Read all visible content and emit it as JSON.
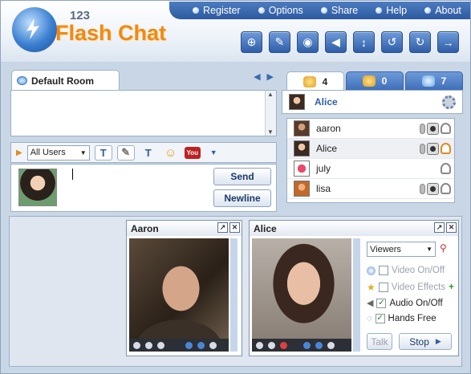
{
  "logo": {
    "number": "123",
    "text": "Flash Chat"
  },
  "topnav": [
    {
      "label": "Register"
    },
    {
      "label": "Options"
    },
    {
      "label": "Share"
    },
    {
      "label": "Help"
    },
    {
      "label": "About"
    }
  ],
  "toolbar": [
    "gamepad-icon",
    "edit-icon",
    "webcam-icon",
    "speaker-icon",
    "resize-icon",
    "history-icon",
    "refresh-icon",
    "logout-icon"
  ],
  "room": {
    "name": "Default Room"
  },
  "options": {
    "user_filter": "All Users",
    "bold": "T",
    "italic": "✎",
    "color": "T",
    "emoticon": "☺",
    "youtube": "You"
  },
  "input": {
    "send": "Send",
    "newline": "Newline"
  },
  "tabs": [
    {
      "count": "4",
      "icon": "users-icon"
    },
    {
      "count": "0",
      "icon": "group-icon"
    },
    {
      "count": "7",
      "icon": "rooms-icon"
    }
  ],
  "me": {
    "name": "Alice"
  },
  "users": [
    {
      "name": "aaron",
      "mic": true,
      "cam": true,
      "person": "gray"
    },
    {
      "name": "Alice",
      "mic": true,
      "cam": true,
      "person": "orange"
    },
    {
      "name": "july",
      "mic": false,
      "cam": false,
      "person": "gray"
    },
    {
      "name": "lisa",
      "mic": true,
      "cam": true,
      "person": "gray"
    }
  ],
  "video": {
    "win1": {
      "title": "Aaron"
    },
    "win2": {
      "title": "Alice"
    },
    "viewers": "Viewers",
    "video_onoff": "Video On/Off",
    "video_effects": "Video Effects",
    "audio_onoff": "Audio On/Off",
    "hands_free": "Hands Free",
    "talk": "Talk",
    "stop": "Stop"
  },
  "colors": {
    "accent": "#2f5ea8",
    "logo": "#f08a10"
  }
}
